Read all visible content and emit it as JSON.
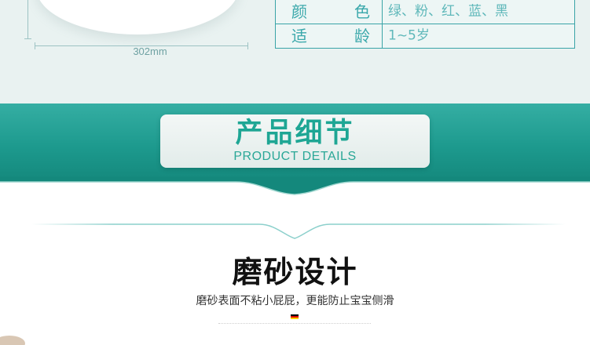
{
  "spec": {
    "dimension_label": "302mm",
    "rows": [
      {
        "key_a": "颜",
        "key_b": "色",
        "value": "绿、粉、红、蓝、黑"
      },
      {
        "key_a": "适",
        "key_b": "龄",
        "value": "1~5岁"
      }
    ]
  },
  "banner": {
    "title_cn": "产品细节",
    "title_en": "PRODUCT DETAILS"
  },
  "feature": {
    "title": "磨砂设计",
    "description": "磨砂表面不粘小屁屁，更能防止宝宝侧滑"
  },
  "colors": {
    "accent": "#1ea694",
    "banner_dark": "#14887c",
    "table_border": "#3aa4a7",
    "spec_bg": "#e9f2f1"
  }
}
